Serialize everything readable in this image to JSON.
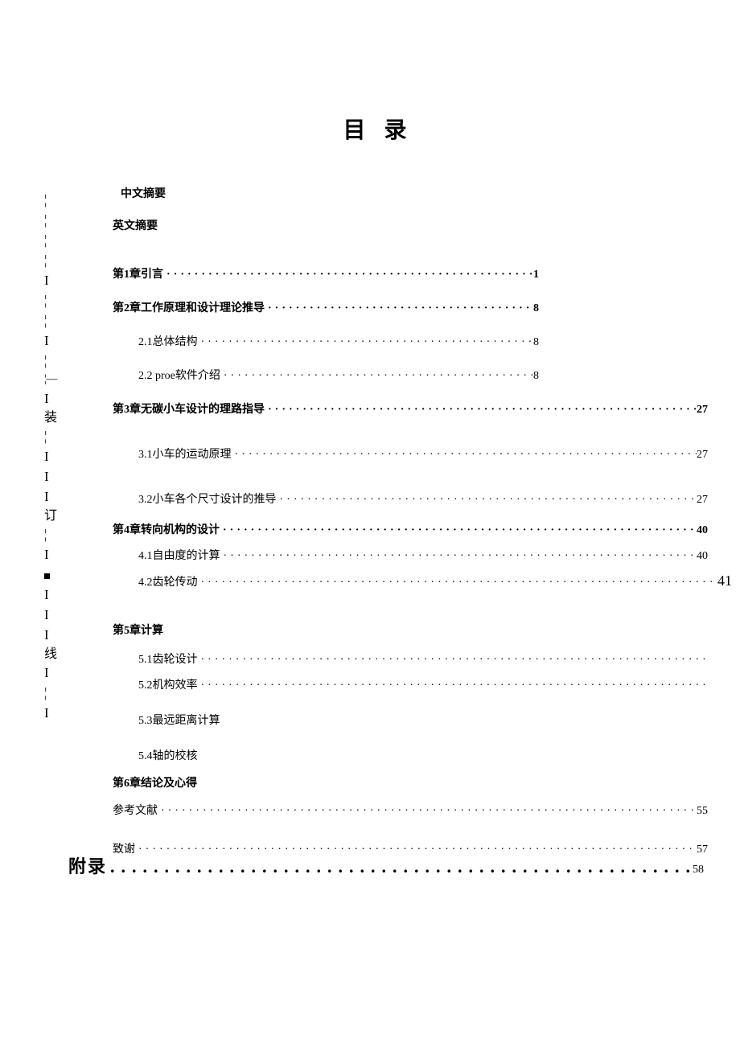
{
  "title": "目 录",
  "abstract_cn": "中文摘要",
  "abstract_en": "英文摘要",
  "ch1": {
    "label": "第1章引言",
    "page": "1"
  },
  "ch2": {
    "label": "第2章工作原理和设计理论推导",
    "page": "8",
    "s1": {
      "label": "2.1总体结构",
      "page": "8"
    },
    "s2": {
      "label": "2.2 proe软件介绍",
      "page": "8"
    }
  },
  "ch3": {
    "label": "第3章无碳小车设计的理路指导",
    "page": "27",
    "s1": {
      "label": "3.1小车的运动原理",
      "page": "27"
    },
    "s2": {
      "label": "3.2小车各个尺寸设计的推导",
      "page": "27"
    }
  },
  "ch4": {
    "label": "第4章转向机构的设计",
    "page": "40",
    "s1": {
      "label": "4.1自由度的计算",
      "page": "40"
    },
    "s2": {
      "label": "4.2齿轮传动",
      "page": "41"
    }
  },
  "ch5": {
    "label": "第5章计算",
    "s1": {
      "label": "5.1齿轮设计"
    },
    "s2": {
      "label": "5.2机构效率"
    },
    "s3": {
      "label": "5.3最远距离计算"
    },
    "s4": {
      "label": "5.4轴的校核"
    }
  },
  "ch6": {
    "label": "第6章结论及心得"
  },
  "refs": {
    "label": "参考文献",
    "page": "55"
  },
  "thanks": {
    "label": "致谢",
    "page": "57"
  },
  "appendix": {
    "label": "附录",
    "page": "58"
  },
  "bind1": "装",
  "bind2": "订",
  "bind3": "线"
}
